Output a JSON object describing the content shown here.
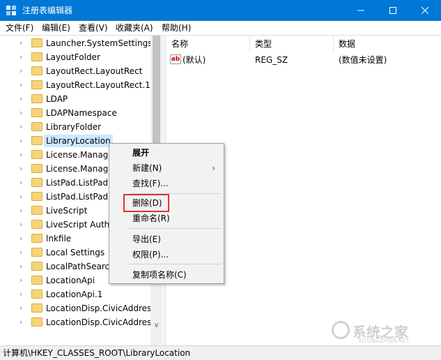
{
  "window": {
    "title": "注册表编辑器",
    "minimize_icon": "minimize-icon",
    "maximize_icon": "maximize-icon",
    "close_icon": "close-icon"
  },
  "menubar": {
    "items": [
      "文件(F)",
      "编辑(E)",
      "查看(V)",
      "收藏夹(A)",
      "帮助(H)"
    ]
  },
  "tree": {
    "items": [
      {
        "label": "Launcher.SystemSettings"
      },
      {
        "label": "LayoutFolder"
      },
      {
        "label": "LayoutRect.LayoutRect"
      },
      {
        "label": "LayoutRect.LayoutRect.1"
      },
      {
        "label": "LDAP"
      },
      {
        "label": "LDAPNamespace"
      },
      {
        "label": "LibraryFolder"
      },
      {
        "label": "LibraryLocation",
        "selected": true
      },
      {
        "label": "License.Manage"
      },
      {
        "label": "License.Manage"
      },
      {
        "label": "ListPad.ListPad"
      },
      {
        "label": "ListPad.ListPad."
      },
      {
        "label": "LiveScript"
      },
      {
        "label": "LiveScript Autho"
      },
      {
        "label": "lnkfile"
      },
      {
        "label": "Local Settings"
      },
      {
        "label": "LocalPathSearch"
      },
      {
        "label": "LocationApi"
      },
      {
        "label": "LocationApi.1"
      },
      {
        "label": "LocationDisp.CivicAddress"
      },
      {
        "label": "LocationDisp.CivicAddress"
      }
    ]
  },
  "values_pane": {
    "columns": [
      "名称",
      "类型",
      "数据"
    ],
    "rows": [
      {
        "name": "(默认)",
        "type": "REG_SZ",
        "data": "(数值未设置)",
        "icon": "ab"
      }
    ]
  },
  "context_menu": {
    "items": [
      {
        "label": "展开",
        "bold": true
      },
      {
        "label": "新建(N)",
        "submenu": true
      },
      {
        "label": "查找(F)..."
      },
      {
        "label": "删除(D)",
        "highlighted": true
      },
      {
        "label": "重命名(R)"
      },
      {
        "label": "导出(E)"
      },
      {
        "label": "权限(P)..."
      },
      {
        "label": "复制项名称(C)"
      }
    ]
  },
  "statusbar": {
    "path": "计算机\\HKEY_CLASSES_ROOT\\LibraryLocation"
  },
  "watermark": {
    "text": "系统之家",
    "sub": "XITONGZHIJIA.NET"
  },
  "colors": {
    "titlebar": "#0078d7",
    "selection": "#cce8ff",
    "highlight_border": "#e23131"
  }
}
